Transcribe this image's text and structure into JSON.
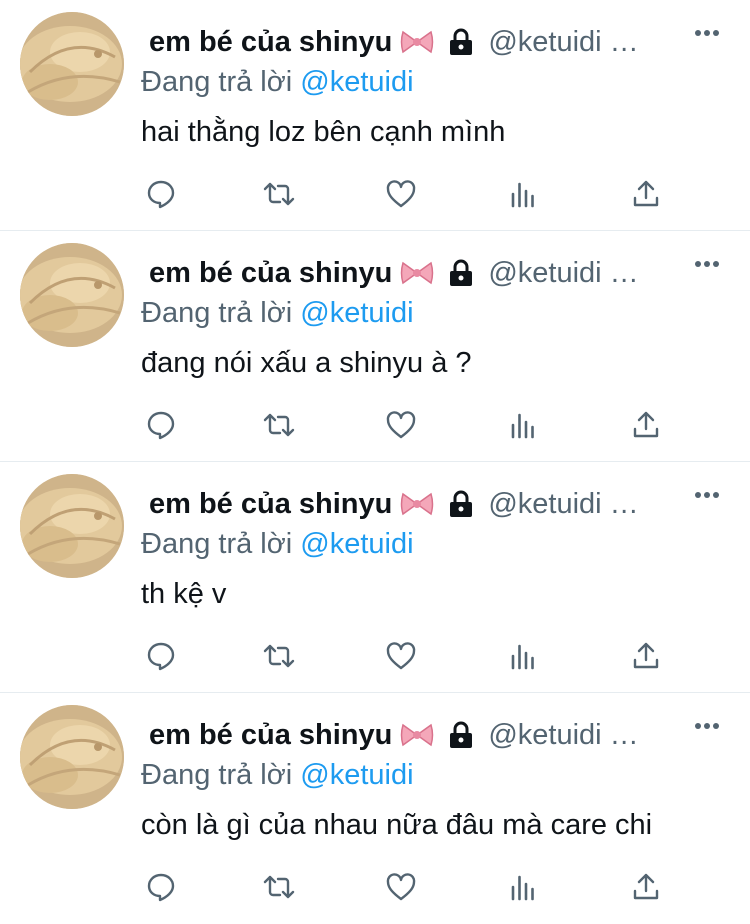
{
  "tweets": [
    {
      "display_name": "em bé của shinyu",
      "handle": "@ketuidi …",
      "reply_prefix": "Đang trả lời ",
      "reply_mention": "@ketuidi",
      "text": "hai thằng loz bên cạnh mình"
    },
    {
      "display_name": "em bé của shinyu",
      "handle": "@ketuidi …",
      "reply_prefix": "Đang trả lời ",
      "reply_mention": "@ketuidi",
      "text": "đang nói xấu a shinyu à ?"
    },
    {
      "display_name": "em bé của shinyu",
      "handle": "@ketuidi …",
      "reply_prefix": "Đang trả lời ",
      "reply_mention": "@ketuidi",
      "text": "th kệ v"
    },
    {
      "display_name": "em bé của shinyu",
      "handle": "@ketuidi …",
      "reply_prefix": "Đang trả lời ",
      "reply_mention": "@ketuidi",
      "text": "còn là gì của nhau nữa đâu mà care chi"
    }
  ],
  "colors": {
    "text": "#0f1419",
    "secondary": "#536471",
    "mention": "#1d9bf0",
    "icon": "#536471",
    "divider": "#e6ecf0"
  }
}
